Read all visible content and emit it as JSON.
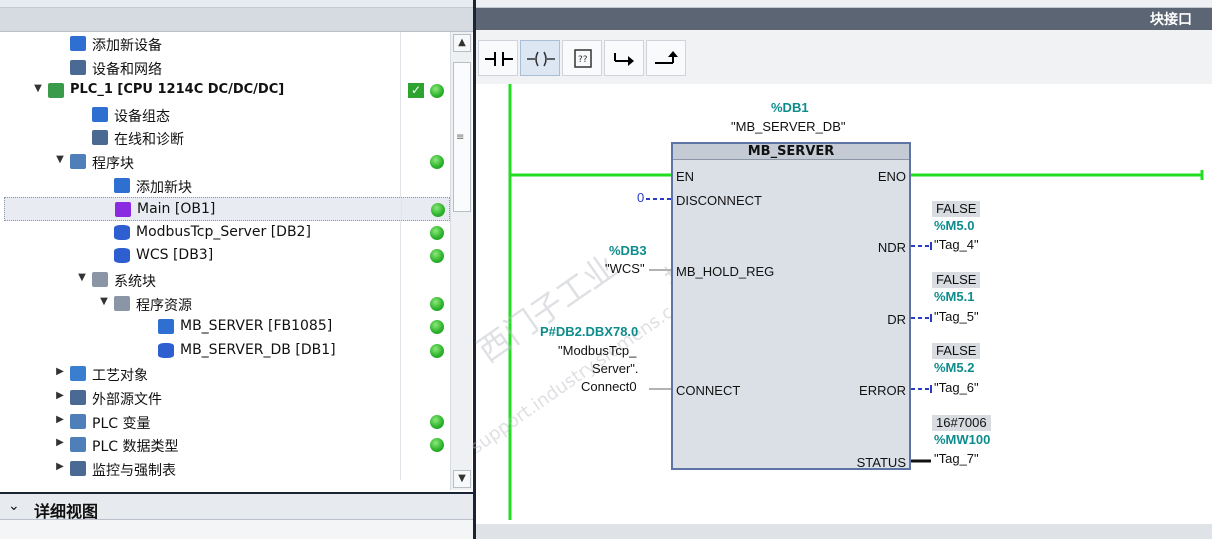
{
  "left_pane": {
    "tree": [
      {
        "label": "添加新设备",
        "icon": "add-device-icon",
        "indent": 1,
        "arrow": "",
        "bold": false,
        "status": ""
      },
      {
        "label": "设备和网络",
        "icon": "network-icon",
        "indent": 1,
        "arrow": "",
        "bold": false,
        "status": ""
      },
      {
        "label": "PLC_1 [CPU 1214C DC/DC/DC]",
        "icon": "plc-icon",
        "indent": 0,
        "arrow": "expanded",
        "bold": true,
        "status": "check+ok"
      },
      {
        "label": "设备组态",
        "icon": "device-config-icon",
        "indent": 2,
        "arrow": "",
        "bold": false,
        "status": ""
      },
      {
        "label": "在线和诊断",
        "icon": "diagnostics-icon",
        "indent": 2,
        "arrow": "",
        "bold": false,
        "status": ""
      },
      {
        "label": "程序块",
        "icon": "folder-icon",
        "indent": 1,
        "arrow": "expanded",
        "bold": false,
        "status": "ok"
      },
      {
        "label": "添加新块",
        "icon": "add-block-icon",
        "indent": 3,
        "arrow": "",
        "bold": false,
        "status": ""
      },
      {
        "label": "Main [OB1]",
        "icon": "ob-icon",
        "indent": 3,
        "arrow": "",
        "bold": false,
        "status": "ok",
        "selected": true
      },
      {
        "label": "ModbusTcp_Server [DB2]",
        "icon": "db-icon",
        "indent": 3,
        "arrow": "",
        "bold": false,
        "status": "ok"
      },
      {
        "label": "WCS [DB3]",
        "icon": "db-icon",
        "indent": 3,
        "arrow": "",
        "bold": false,
        "status": "ok"
      },
      {
        "label": "系统块",
        "icon": "system-folder-icon",
        "indent": 2,
        "arrow": "expanded",
        "bold": false,
        "status": ""
      },
      {
        "label": "程序资源",
        "icon": "system-folder-icon",
        "indent": 3,
        "arrow": "expanded",
        "bold": false,
        "status": "ok"
      },
      {
        "label": "MB_SERVER [FB1085]",
        "icon": "fb-icon",
        "indent": 5,
        "arrow": "",
        "bold": false,
        "status": "ok"
      },
      {
        "label": "MB_SERVER_DB [DB1]",
        "icon": "db-icon",
        "indent": 5,
        "arrow": "",
        "bold": false,
        "status": "ok"
      },
      {
        "label": "工艺对象",
        "icon": "tech-objects-icon",
        "indent": 1,
        "arrow": "collapsed",
        "bold": false,
        "status": ""
      },
      {
        "label": "外部源文件",
        "icon": "external-source-icon",
        "indent": 1,
        "arrow": "collapsed",
        "bold": false,
        "status": ""
      },
      {
        "label": "PLC 变量",
        "icon": "tag-table-icon",
        "indent": 1,
        "arrow": "collapsed",
        "bold": false,
        "status": "ok"
      },
      {
        "label": "PLC 数据类型",
        "icon": "data-type-icon",
        "indent": 1,
        "arrow": "collapsed",
        "bold": false,
        "status": "ok"
      },
      {
        "label": "监控与强制表",
        "icon": "watch-table-icon",
        "indent": 1,
        "arrow": "collapsed",
        "bold": false,
        "status": ""
      }
    ],
    "detail_view_title": "详细视图"
  },
  "right_pane": {
    "header_title": "块接口",
    "toolbar": [
      {
        "name": "no-contact-button",
        "icon": "normally-open-contact-icon"
      },
      {
        "name": "coil-button",
        "icon": "coil-icon",
        "active": true
      },
      {
        "name": "empty-box-button",
        "icon": "empty-box-icon"
      },
      {
        "name": "open-branch-button",
        "icon": "open-branch-icon"
      },
      {
        "name": "close-branch-button",
        "icon": "close-branch-icon"
      }
    ]
  },
  "ladder": {
    "instance_db_address": "%DB1",
    "instance_db_name": "\"MB_SERVER_DB\"",
    "block_name": "MB_SERVER",
    "pins_left": {
      "en": "EN",
      "disconnect": "DISCONNECT",
      "hold_reg": "MB_HOLD_REG",
      "connect": "CONNECT"
    },
    "pins_right": {
      "eno": "ENO",
      "ndr": "NDR",
      "dr": "DR",
      "error": "ERROR",
      "status": "STATUS"
    },
    "inputs": {
      "disconnect_value": "0",
      "hold_reg_address": "%DB3",
      "hold_reg_name": "\"WCS\"",
      "connect_address": "P#DB2.DBX78.0",
      "connect_name_line1": "\"ModbusTcp_",
      "connect_name_line2": "Server\".",
      "connect_name_line3": "Connect0"
    },
    "outputs": {
      "ndr_value": "FALSE",
      "ndr_address": "%M5.0",
      "ndr_tag": "\"Tag_4\"",
      "dr_value": "FALSE",
      "dr_address": "%M5.1",
      "dr_tag": "\"Tag_5\"",
      "error_value": "FALSE",
      "error_address": "%M5.2",
      "error_tag": "\"Tag_6\"",
      "status_value": "16#7006",
      "status_address": "%MW100",
      "status_tag": "\"Tag_7\""
    },
    "colors": {
      "power_flow": "#22dd22",
      "address": "#0e8c8c",
      "block_border": "#5f74a6"
    }
  }
}
